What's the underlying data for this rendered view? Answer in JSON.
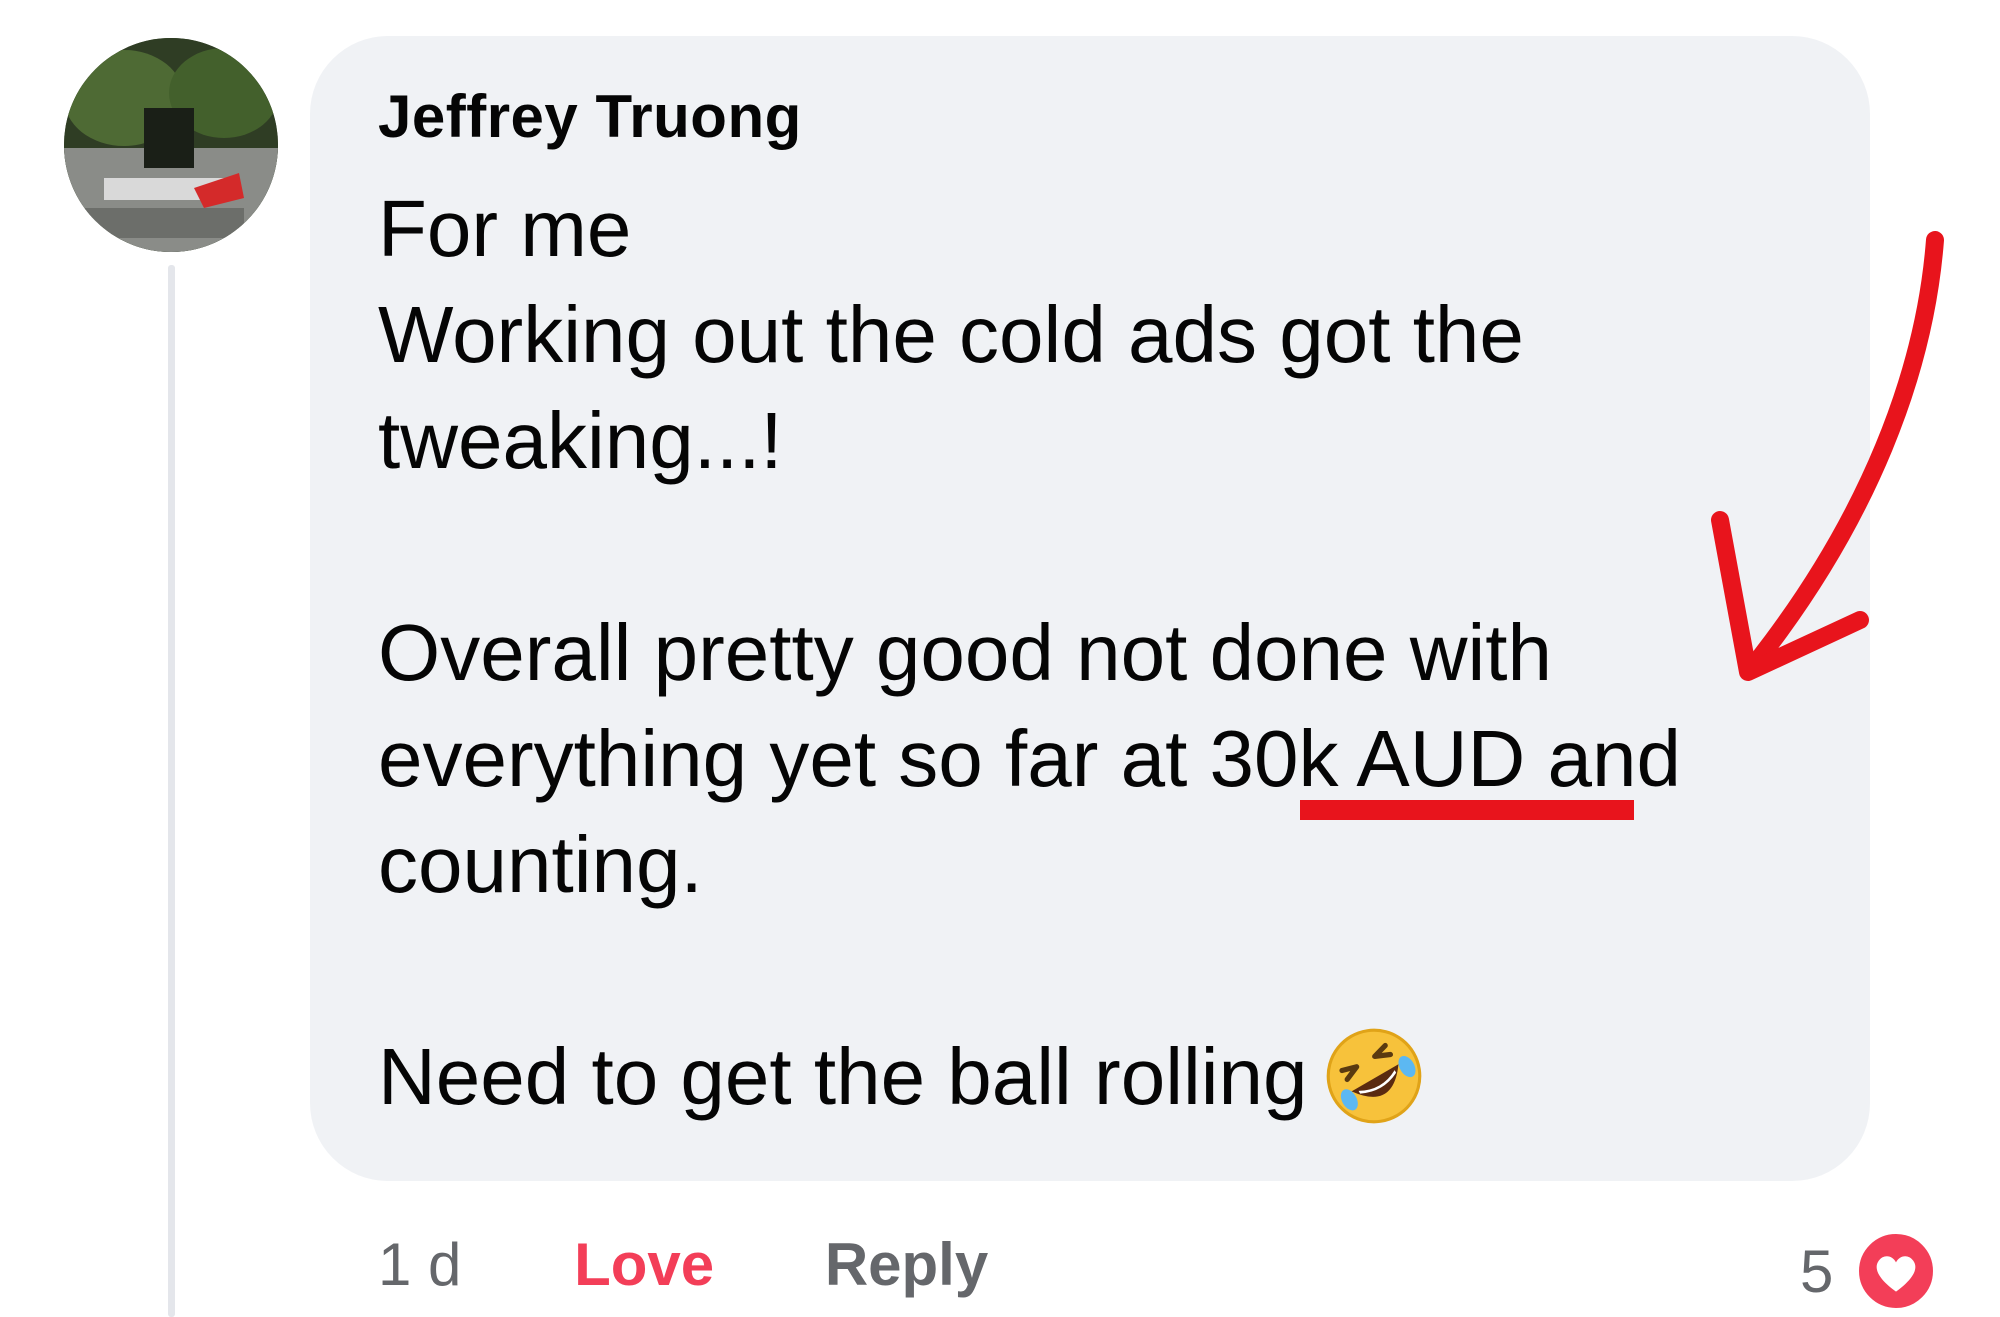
{
  "comment": {
    "author": "Jeffrey Truong",
    "lines": [
      "For me",
      "Working out the cold ads got the",
      "tweaking...!"
    ],
    "paragraph2_line1": "Overall pretty good not done with",
    "paragraph2_line2_pre": "everything yet so far at ",
    "paragraph2_highlight": "30k AUD",
    "paragraph2_line2_post": " and",
    "paragraph2_line3": "counting.",
    "paragraph3": "Need to get the ball rolling",
    "emoji": "rolling-on-floor-laughing-emoji"
  },
  "actions": {
    "time": "1 d",
    "love": "Love",
    "reply": "Reply"
  },
  "reactions": {
    "count": "5",
    "icon": "love-reaction-icon"
  },
  "colors": {
    "bubble": "#f0f2f5",
    "love": "#f33e58",
    "annotation": "#e8141c",
    "muted": "#65676b"
  }
}
